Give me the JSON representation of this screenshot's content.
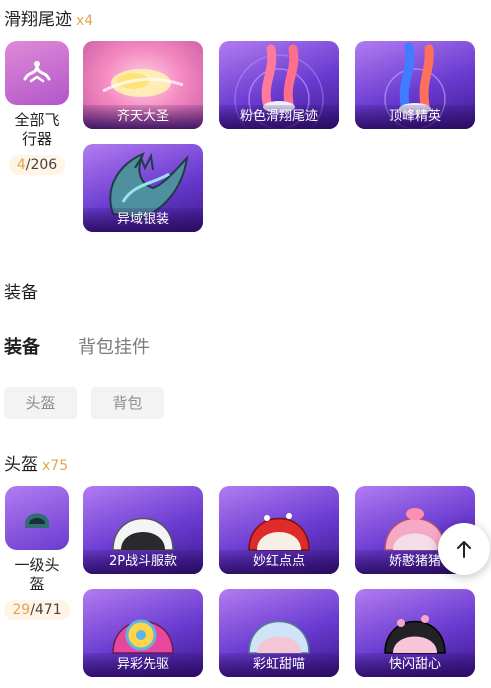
{
  "trails": {
    "title": "滑翔尾迹",
    "count": "x4",
    "summary": {
      "label_line1": "全部飞",
      "label_line2": "行器",
      "owned": "4",
      "total": "/206"
    },
    "items": [
      {
        "name": "齐天大圣"
      },
      {
        "name": "粉色滑翔尾迹"
      },
      {
        "name": "顶峰精英"
      },
      {
        "name": "异域银装"
      }
    ]
  },
  "equipment": {
    "heading": "装备",
    "tabs": [
      {
        "label": "装备",
        "active": true
      },
      {
        "label": "背包挂件",
        "active": false
      }
    ],
    "chips": [
      {
        "label": "头盔"
      },
      {
        "label": "背包"
      }
    ]
  },
  "helmets": {
    "title": "头盔",
    "count": "x75",
    "summary": {
      "label_line1": "一级头",
      "label_line2": "盔",
      "owned": "29",
      "total": "/471"
    },
    "items": [
      {
        "name": "2P战斗服款"
      },
      {
        "name": "妙红点点"
      },
      {
        "name": "娇憨猪猪"
      },
      {
        "name": "异彩先驱"
      },
      {
        "name": "彩虹甜喵"
      },
      {
        "name": "快闪甜心"
      }
    ]
  },
  "fab": {
    "icon": "arrow-up-icon"
  }
}
